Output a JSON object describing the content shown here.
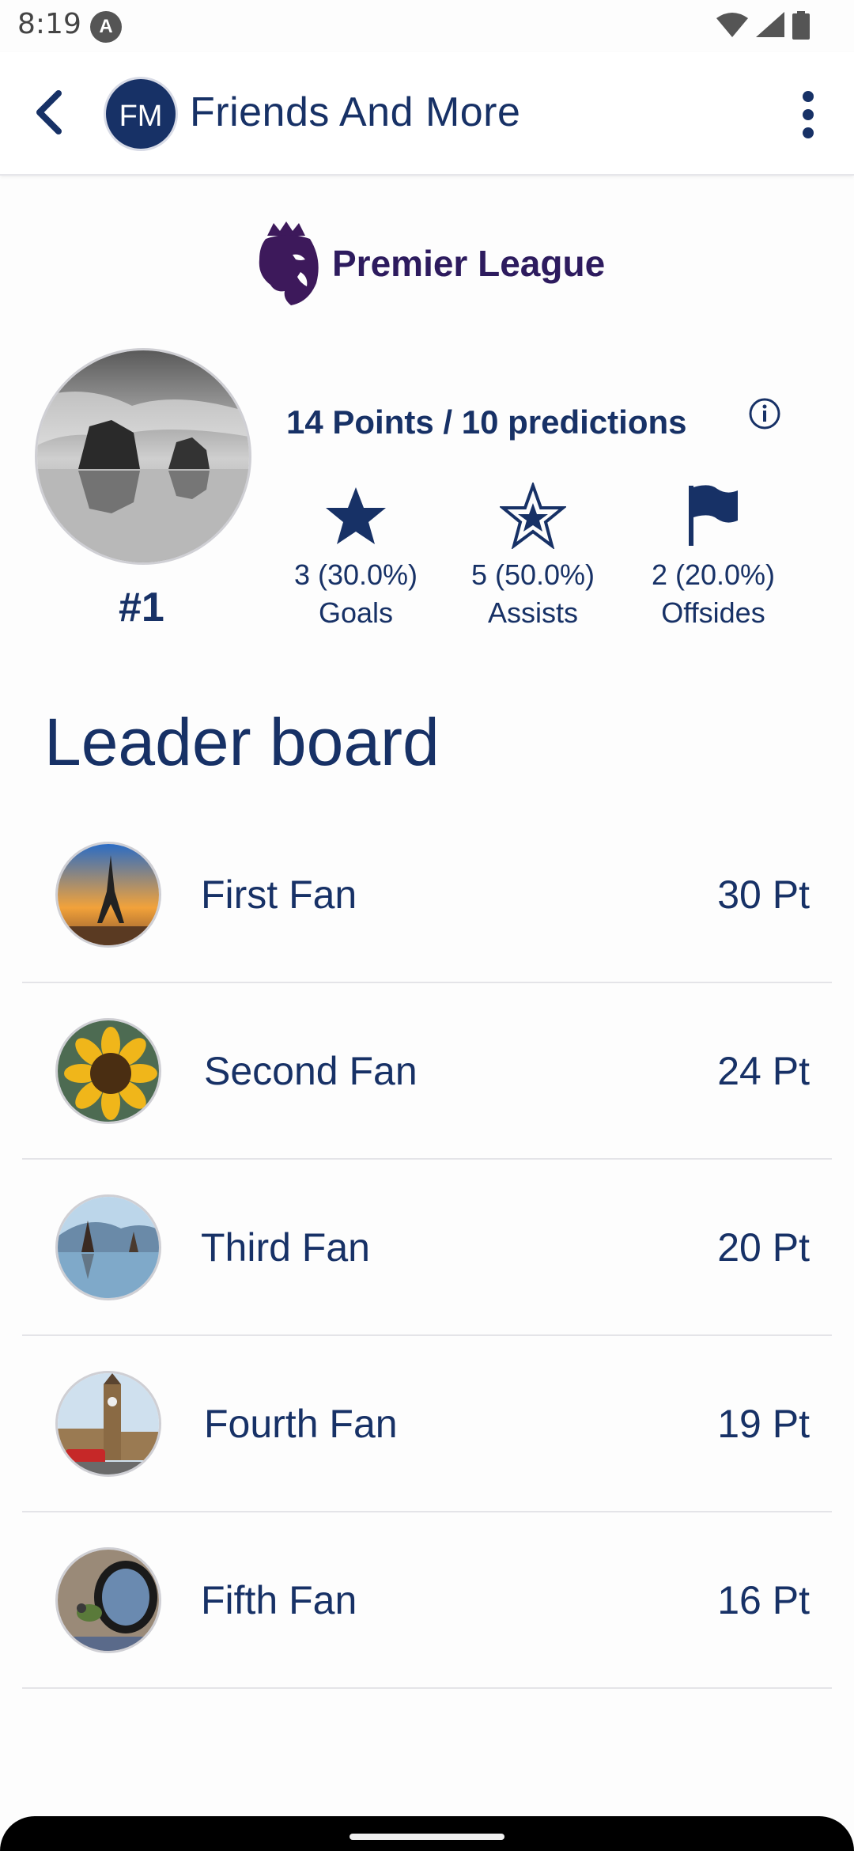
{
  "status_bar": {
    "time": "8:19",
    "indicator": "A"
  },
  "app_bar": {
    "avatar_initials": "FM",
    "title": "Friends And More"
  },
  "league": {
    "name": "Premier League"
  },
  "profile": {
    "rank": "#1",
    "summary": "14 Points / 10 predictions",
    "stats": [
      {
        "icon": "star-filled-icon",
        "value": "3 (30.0%)",
        "label": "Goals"
      },
      {
        "icon": "star-outline-icon",
        "value": "5 (50.0%)",
        "label": "Assists"
      },
      {
        "icon": "flag-icon",
        "value": "2 (20.0%)",
        "label": "Offsides"
      }
    ]
  },
  "leaderboard": {
    "title": "Leader board",
    "rows": [
      {
        "name": "First Fan",
        "points": "30 Pt"
      },
      {
        "name": "Second Fan",
        "points": "24 Pt"
      },
      {
        "name": "Third Fan",
        "points": "20 Pt"
      },
      {
        "name": "Fourth Fan",
        "points": "19 Pt"
      },
      {
        "name": "Fifth Fan",
        "points": "16 Pt"
      }
    ]
  },
  "colors": {
    "primary": "#173166",
    "league": "#2d1b5e",
    "divider": "#e4e4e8"
  }
}
